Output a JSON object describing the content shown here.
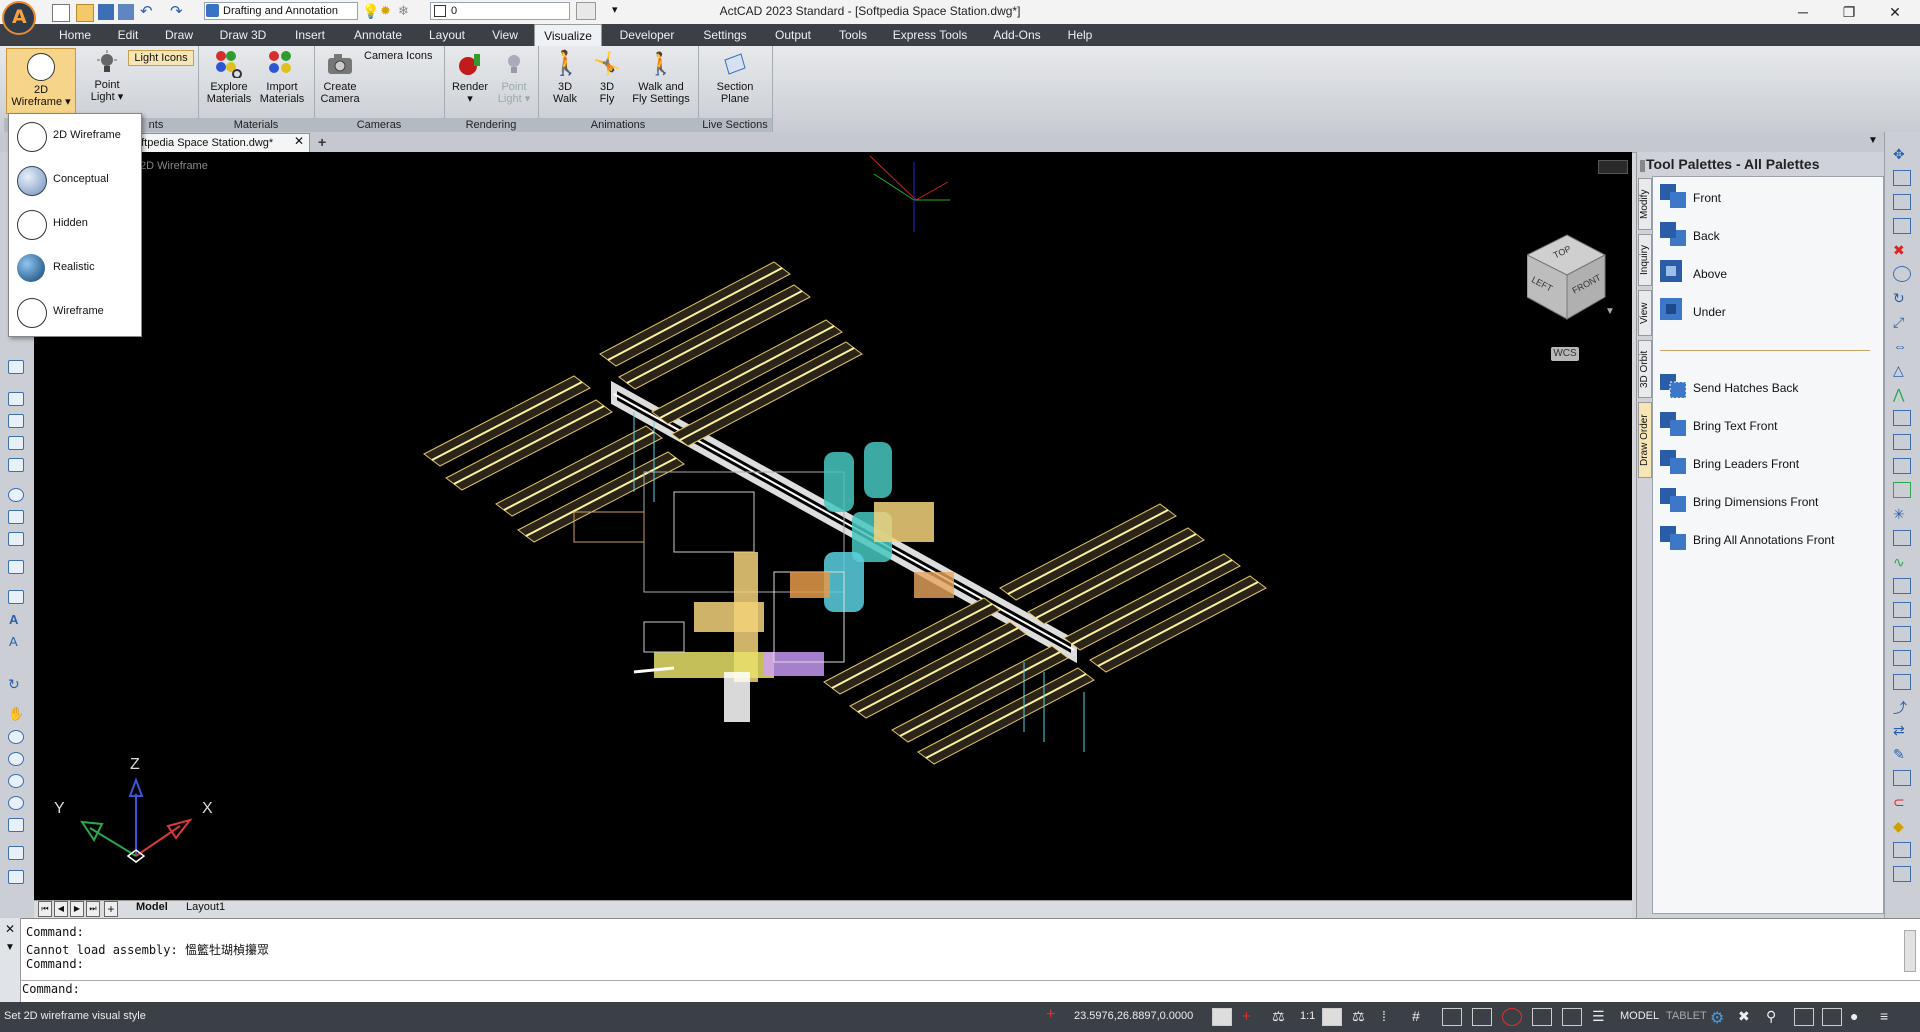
{
  "window": {
    "title": "ActCAD 2023 Standard - [Softpedia Space Station.dwg*]"
  },
  "quick_access": {
    "workspace": "Drafting and Annotation",
    "layer": "0"
  },
  "menu_tabs": [
    "Home",
    "Edit",
    "Draw",
    "Draw 3D",
    "Insert",
    "Annotate",
    "Layout",
    "View",
    "Visualize",
    "Developer",
    "Settings",
    "Output",
    "Tools",
    "Express Tools",
    "Add-Ons",
    "Help"
  ],
  "active_tab": "Visualize",
  "ribbon": {
    "visual_style": {
      "label1": "2D",
      "label2": "Wireframe ▾"
    },
    "light_icons": "Light Icons",
    "point_light": {
      "label1": "Point",
      "label2": "Light ▾"
    },
    "lights_group": "nts",
    "explore_materials": {
      "label1": "Explore",
      "label2": "Materials"
    },
    "import_materials": {
      "label1": "Import",
      "label2": "Materials"
    },
    "materials_group": "Materials",
    "camera_icons": "Camera Icons",
    "create_camera": {
      "label1": "Create",
      "label2": "Camera"
    },
    "cameras_group": "Cameras",
    "render": {
      "label1": "Render",
      "label2": "▾"
    },
    "point_light2": {
      "label1": "Point",
      "label2": "Light ▾"
    },
    "rendering_group": "Rendering",
    "walk3d": {
      "label1": "3D",
      "label2": "Walk"
    },
    "fly3d": {
      "label1": "3D",
      "label2": "Fly"
    },
    "walkfly": {
      "label1": "Walk and",
      "label2": "Fly Settings"
    },
    "animations_group": "Animations",
    "section_plane": {
      "label1": "Section",
      "label2": "Plane"
    },
    "live_sections_group": "Live Sections"
  },
  "document_tab": "oftpedia Space Station.dwg*",
  "canvas_label": "2D Wireframe",
  "visual_styles": [
    {
      "label": "2D Wireframe",
      "color": "#ffffff"
    },
    {
      "label": "Conceptual",
      "color": "#9fb8d8"
    },
    {
      "label": "Hidden",
      "color": "#ffffff"
    },
    {
      "label": "Realistic",
      "color": "#1e6aa8"
    },
    {
      "label": "Wireframe",
      "color": "#ffffff"
    }
  ],
  "viewcube": {
    "top": "TOP",
    "left": "LEFT",
    "front": "FRONT",
    "wcs": "WCS"
  },
  "ucs": {
    "x": "X",
    "y": "Y",
    "z": "Z"
  },
  "layout_tabs": {
    "model": "Model",
    "layout1": "Layout1"
  },
  "palette": {
    "title": "Tool Palettes - All Palettes",
    "side_tabs": [
      "Modify",
      "Inquiry",
      "View",
      "3D Orbit",
      "Draw Order"
    ],
    "items": [
      "Front",
      "Back",
      "Above",
      "Under",
      "Send Hatches Back",
      "Bring Text Front",
      "Bring Leaders Front",
      "Bring Dimensions Front",
      "Bring All Annotations Front"
    ]
  },
  "command": {
    "line1": "Command:",
    "line2": "Cannot load assembly: 慍籃牡瑚楨攥眾",
    "line3": "Command:",
    "prompt": "Command:"
  },
  "status": {
    "message": "Set 2D wireframe visual style",
    "coords": "23.5976,26.8897,0.0000",
    "scale": "1:1",
    "model": "MODEL",
    "tablet": "TABLET"
  },
  "colors": {
    "accent": "#3b3f46",
    "panel_line": "#e0c26b",
    "highlight": "#f7e6b5"
  }
}
